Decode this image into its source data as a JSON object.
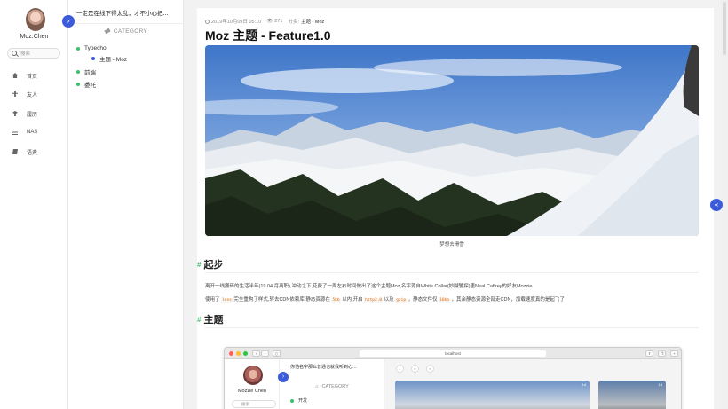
{
  "sidebar": {
    "username": "Moz.Chen",
    "search_placeholder": "搜索",
    "items": [
      {
        "label": "首页",
        "icon": "home-icon"
      },
      {
        "label": "友人",
        "icon": "friends-icon"
      },
      {
        "label": "履历",
        "icon": "history-icon"
      },
      {
        "label": "NAS",
        "icon": "list-icon"
      },
      {
        "label": "语典",
        "icon": "book-icon"
      }
    ]
  },
  "column2": {
    "tagline": "一定是在线下得太乱，才不小心把...",
    "category_heading": "CATEGORY",
    "categories": [
      {
        "label": "Typecho",
        "dot": "#3dc06c"
      },
      {
        "label": "主题 - Moz",
        "dot": "#3b5bdb"
      },
      {
        "label": "前端",
        "dot": "#3dc06c"
      },
      {
        "label": "委托",
        "dot": "#3dc06c"
      }
    ]
  },
  "post": {
    "date": "2019年10月09日 05:10",
    "views": "271",
    "category_prefix": "分类:",
    "category": "主题 - Moz",
    "title": "Moz 主题 - Feature1.0",
    "image_caption": "梦想去滑雪",
    "section1_heading": "起步",
    "para1": "离开一线搬砖的生活半年(19.04 月离职),冲动之下,花费了一周左右时间做出了这个主题Moz,名字源自White Collar(妙贼警探)里Neal Caffrey的好友Mozzie",
    "para2_a": "使用了",
    "para2_code1": "less",
    "para2_b": "完全重构了样式,转去CDN依赖库,静态资源在",
    "para2_code2": "5kb",
    "para2_c": "以内,开启",
    "para2_code3": "http2.0",
    "para2_d": "以及",
    "para2_code4": "gzip",
    "para2_e": "，静态文件仅",
    "para2_code5": "10kb",
    "para2_f": "，其余静态资源全部走CDN，加载速度真的是起飞了",
    "section2_heading": "主题"
  },
  "screenshot": {
    "url": "localhost",
    "username": "Mozzie Chen",
    "tagline": "你怕名字那么普通也就我听到心...",
    "category_heading": "CATEGORY",
    "first_category": "开发",
    "search_placeholder": "搜索",
    "card_badge_1": "1d",
    "card_badge_2": "1d"
  },
  "colors": {
    "accent": "#3b5bdb",
    "green": "#3dc06c"
  }
}
